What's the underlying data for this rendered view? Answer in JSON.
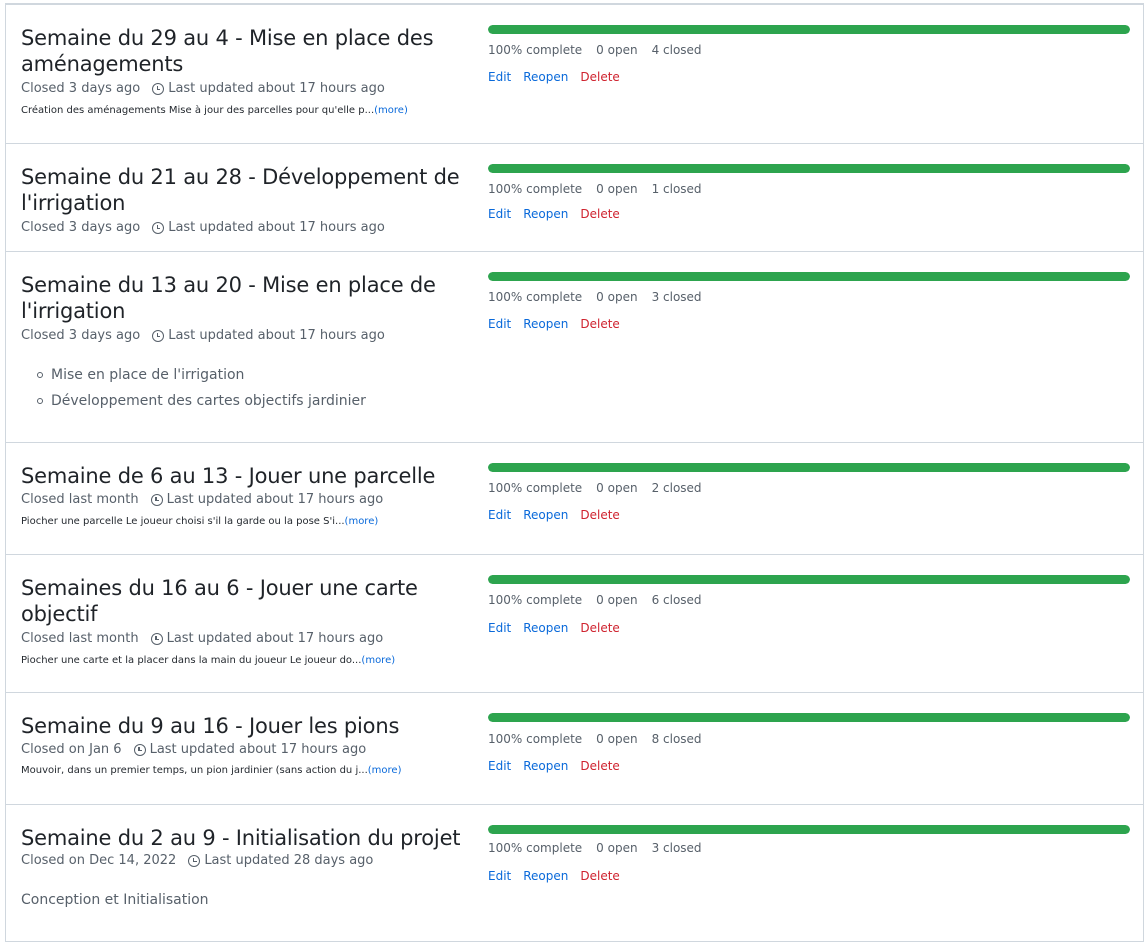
{
  "milestones": [
    {
      "title": "Semaine du 29 au 4 - Mise en place des aménagements",
      "closed": "Closed 3 days ago",
      "updated": "Last updated about 17 hours ago",
      "description": "Création des aménagements Mise à jour des parcelles pour qu'elle p...",
      "more": "(more)",
      "progress_percent": 100,
      "complete": "100% complete",
      "open": "0 open",
      "closed_count": "4 closed"
    },
    {
      "title": "Semaine du 21 au 28 - Développement de l'irrigation",
      "closed": "Closed 3 days ago",
      "updated": "Last updated about 17 hours ago",
      "progress_percent": 100,
      "complete": "100% complete",
      "open": "0 open",
      "closed_count": "1 closed"
    },
    {
      "title": "Semaine du 13 au 20 - Mise en place de l'irrigation",
      "closed": "Closed 3 days ago",
      "updated": "Last updated about 17 hours ago",
      "bullets": [
        "Mise en place de l'irrigation",
        "Développement des cartes objectifs jardinier"
      ],
      "progress_percent": 100,
      "complete": "100% complete",
      "open": "0 open",
      "closed_count": "3 closed"
    },
    {
      "title": "Semaine de 6 au 13 - Jouer une parcelle",
      "closed": "Closed last month",
      "updated": "Last updated about 17 hours ago",
      "description": "Piocher une parcelle Le joueur choisi s'il la garde ou la pose S'i...",
      "more": "(more)",
      "progress_percent": 100,
      "complete": "100% complete",
      "open": "0 open",
      "closed_count": "2 closed"
    },
    {
      "title": "Semaines du 16 au 6 - Jouer une carte objectif",
      "closed": "Closed last month",
      "updated": "Last updated about 17 hours ago",
      "description": "Piocher une carte et la placer dans la main du joueur Le joueur do...",
      "more": "(more)",
      "progress_percent": 100,
      "complete": "100% complete",
      "open": "0 open",
      "closed_count": "6 closed"
    },
    {
      "title": "Semaine du 9 au 16 - Jouer les pions",
      "closed": "Closed on Jan 6",
      "updated": "Last updated about 17 hours ago",
      "description": "Mouvoir, dans un premier temps, un pion jardinier (sans action du j...",
      "more": "(more)",
      "progress_percent": 100,
      "complete": "100% complete",
      "open": "0 open",
      "closed_count": "8 closed"
    },
    {
      "title": "Semaine du 2 au 9 - Initialisation du projet",
      "closed": "Closed on Dec 14, 2022",
      "updated": "Last updated 28 days ago",
      "plain_description": "Conception et Initialisation",
      "progress_percent": 100,
      "complete": "100% complete",
      "open": "0 open",
      "closed_count": "3 closed"
    }
  ],
  "actions": {
    "edit": "Edit",
    "reopen": "Reopen",
    "delete": "Delete"
  },
  "colors": {
    "progress": "#2da44e",
    "link": "#0969da",
    "danger": "#cf222e"
  },
  "icons": {
    "updated": "clock-icon"
  }
}
